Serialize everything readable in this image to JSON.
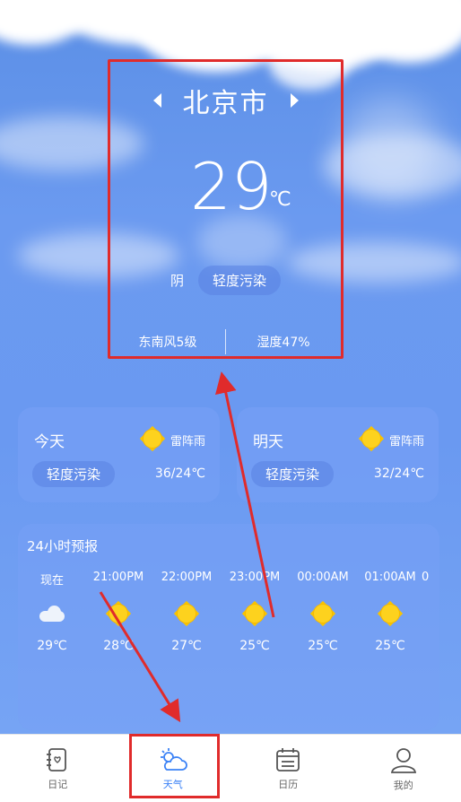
{
  "header": {
    "city": "北京市",
    "temperature": "29",
    "temp_unit": "℃",
    "condition": "阴",
    "air_quality": "轻度污染",
    "wind": "东南风5级",
    "humidity": "湿度47%"
  },
  "days": [
    {
      "name": "今天",
      "weather": "雷阵雨",
      "air_quality": "轻度污染",
      "range": "36/24℃",
      "icon": "sun-icon"
    },
    {
      "name": "明天",
      "weather": "雷阵雨",
      "air_quality": "轻度污染",
      "range": "32/24℃",
      "icon": "sun-icon"
    }
  ],
  "hourly": {
    "title": "24小时预报",
    "items": [
      {
        "time": "现在",
        "icon": "cloud-icon",
        "temp": "29℃"
      },
      {
        "time": "21:00PM",
        "icon": "sun-icon",
        "temp": "28℃"
      },
      {
        "time": "22:00PM",
        "icon": "sun-icon",
        "temp": "27℃"
      },
      {
        "time": "23:00PM",
        "icon": "sun-icon",
        "temp": "25℃"
      },
      {
        "time": "00:00AM",
        "icon": "sun-icon",
        "temp": "25℃"
      },
      {
        "time": "01:00AM",
        "icon": "sun-icon",
        "temp": "25℃"
      },
      {
        "time": "0",
        "icon": "",
        "temp": ""
      }
    ]
  },
  "tabs": [
    {
      "label": "日记",
      "icon": "diary-icon"
    },
    {
      "label": "天气",
      "icon": "weather-icon",
      "active": true
    },
    {
      "label": "日历",
      "icon": "calendar-icon"
    },
    {
      "label": "我的",
      "icon": "profile-icon"
    }
  ],
  "colors": {
    "sky": "#6a99f1",
    "annotation": "#e02b2b",
    "active_tab": "#3b82f6",
    "sun": "#fdd21e"
  }
}
